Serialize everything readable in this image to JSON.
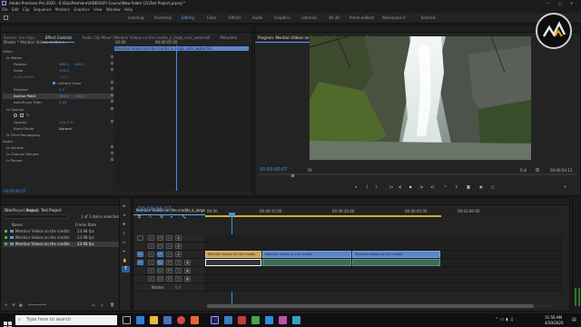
{
  "title_bar": {
    "title": "Adobe Premiere Pro 2020 - E:\\Sky\\Premiere\\VIDEOS\\Pr Course\\New folder (2)\\Test Project.prproj *"
  },
  "menu": [
    "File",
    "Edit",
    "Clip",
    "Sequence",
    "Markers",
    "Graphics",
    "View",
    "Window",
    "Help"
  ],
  "workspaces": [
    "Learning",
    "Assembly",
    "Editing",
    "Color",
    "Effects",
    "Audio",
    "Graphics",
    "Libraries",
    "4K 3D",
    "PremiumBeat",
    "Workspace 4",
    "Tutorials"
  ],
  "workspace_active": "Editing",
  "effect_controls": {
    "tabs": [
      "Source: (no clips)",
      "Effect Controls",
      "Audio Clip Mixer: Mention Videos on the credits_k_large_rock_waterfall",
      "Metadata"
    ],
    "master_label": "Master * Mention Videos on the c...",
    "clip_label": "Mention Videos on the credits_k_large_rock_waterfall",
    "header_times": [
      "00:00",
      "00:00:05:00"
    ],
    "clip_bar_label": "Mention Videos on the credits_k_large_rock_waterfall",
    "rows": [
      {
        "label": "Video",
        "value": "",
        "value2": ""
      },
      {
        "label": "fx Motion",
        "value": "",
        "value2": ""
      },
      {
        "label": "Position",
        "value": "960.0",
        "value2": "540.0"
      },
      {
        "label": "Scale",
        "value": "100.0",
        "value2": ""
      },
      {
        "label": "Scale Width",
        "value": "100.0",
        "value2": ""
      },
      {
        "label": "",
        "value": "Uniform Scale",
        "value2": ""
      },
      {
        "label": "Rotation",
        "value": "0.0",
        "value2": ""
      },
      {
        "label": "Anchor Point",
        "value": "960.0",
        "value2": "540.0"
      },
      {
        "label": "Anti-flicker Filter",
        "value": "0.00",
        "value2": ""
      },
      {
        "label": "fx Opacity",
        "value": "",
        "value2": ""
      },
      {
        "label": "",
        "value": "",
        "value2": ""
      },
      {
        "label": "Opacity",
        "value": "100.0 %",
        "value2": ""
      },
      {
        "label": "Blend Mode",
        "value": "Normal",
        "value2": ""
      },
      {
        "label": "fx Time Remapping",
        "value": "",
        "value2": ""
      },
      {
        "label": "Audio",
        "value": "",
        "value2": ""
      },
      {
        "label": "fx Volume",
        "value": "",
        "value2": ""
      },
      {
        "label": "fx Channel Volume",
        "value": "",
        "value2": ""
      },
      {
        "label": "fx Panner",
        "value": "",
        "value2": ""
      }
    ],
    "footer_time": "00:00:06:07"
  },
  "program_monitor": {
    "title": "Program: Mention Videos on the credits_k_large_rock_waterfall",
    "timecode": "00:00:06:07",
    "fit": "Fit",
    "quality": "Full",
    "duration": "00:00:54:13"
  },
  "project_panel": {
    "tabs": [
      "Effects",
      "Project: Test Project"
    ],
    "file": "Test Project.prproj",
    "selection_info": "1 of 3 items selected",
    "columns": [
      "Name",
      "Frame Rate"
    ],
    "items": [
      {
        "name": "Mention Videos on the credits",
        "rate": "23.98 fps",
        "color": "#4caf50"
      },
      {
        "name": "Mention Videos on the credits",
        "rate": "23.98 fps",
        "color": "#4caf50"
      },
      {
        "name": "Mention Videos on the credits",
        "rate": "23.98 fps",
        "color": "#4caf50"
      }
    ]
  },
  "timeline": {
    "tab": "Mention Videos on the credits_k_large_rock_waterfall",
    "timecode": "00:00:06:07",
    "ruler": [
      "00:00",
      "00:00:15:00",
      "00:00:30:00",
      "00:00:45:00",
      "00:01:00:00"
    ],
    "video_tracks": [
      "V3",
      "V2",
      "V1"
    ],
    "audio_tracks": [
      "A1",
      "A2",
      "A3"
    ],
    "mix_label": "Master",
    "mix_value": "0.0",
    "clip_labels": [
      "Mention Videos on the credits",
      "Mention Videos on the credits",
      "Mention Videos on the credits"
    ]
  },
  "taskbar": {
    "search_placeholder": "Type here to search",
    "time": "11:50 AM",
    "date": "4/20/2020"
  },
  "colors": {
    "accent": "#5aa8ff",
    "clip_video": "#5b86c7",
    "clip_audio": "#3c6b5a",
    "selection": "#2f5d8f"
  }
}
